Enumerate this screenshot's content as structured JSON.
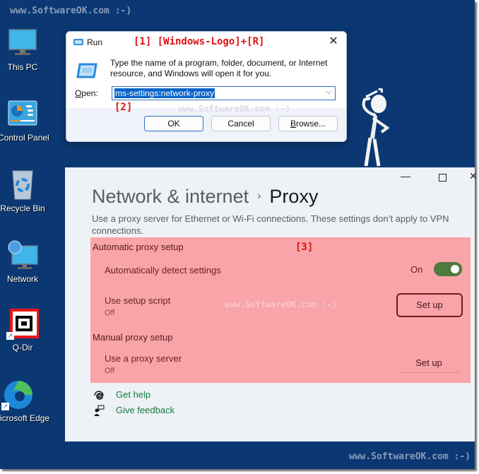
{
  "watermark": {
    "text": "www.SoftwareOK.com :-)"
  },
  "desktop_icons": [
    {
      "label": "This PC",
      "icon": "monitor-icon"
    },
    {
      "label": "Control Panel",
      "icon": "control-panel-icon"
    },
    {
      "label": "Recycle Bin",
      "icon": "recycle-bin-icon"
    },
    {
      "label": "Network",
      "icon": "network-icon"
    },
    {
      "label": "Q-Dir",
      "icon": "q-dir-icon",
      "shortcut": true
    },
    {
      "label": "Microsoft Edge",
      "icon": "edge-icon",
      "shortcut": true
    }
  ],
  "run_dialog": {
    "title": "Run",
    "annotation": "[1]  [Windows-Logo]+[R]",
    "description": "Type the name of a program, folder, document, or Internet resource, and Windows will open it for you.",
    "open_label_prefix": "O",
    "open_label_rest": "pen:",
    "input_value": "ms-settings:network-proxy",
    "input_annotation": "[2]",
    "buttons": {
      "ok": "OK",
      "cancel": "Cancel",
      "browse_prefix": "B",
      "browse_rest": "rowse..."
    },
    "close_glyph": "✕",
    "dropdown_glyph": "⌵"
  },
  "settings_window": {
    "controls": {
      "minimize": "—",
      "close": "✕"
    },
    "breadcrumb": {
      "parent": "Network & internet",
      "separator": "›",
      "current": "Proxy"
    },
    "description": "Use a proxy server for Ethernet or Wi-Fi connections. These settings don’t apply to VPN connections.",
    "annotation": "[3]",
    "automatic": {
      "heading": "Automatic proxy setup",
      "detect_label": "Automatically detect settings",
      "detect_state": "On",
      "detect_enabled": true,
      "script_label": "Use setup script",
      "script_state": "Off",
      "script_button": "Set up"
    },
    "manual": {
      "heading": "Manual proxy setup",
      "server_label": "Use a proxy server",
      "server_state": "Off",
      "server_button": "Set up"
    },
    "links": {
      "get_help": "Get help",
      "give_feedback": "Give feedback"
    }
  },
  "colors": {
    "desktop_bg": "#0b3873",
    "highlight": "#f8a4a8",
    "annotation_red": "#e01010",
    "toggle_on": "#4e7a3c",
    "link_green": "#157a3f"
  }
}
